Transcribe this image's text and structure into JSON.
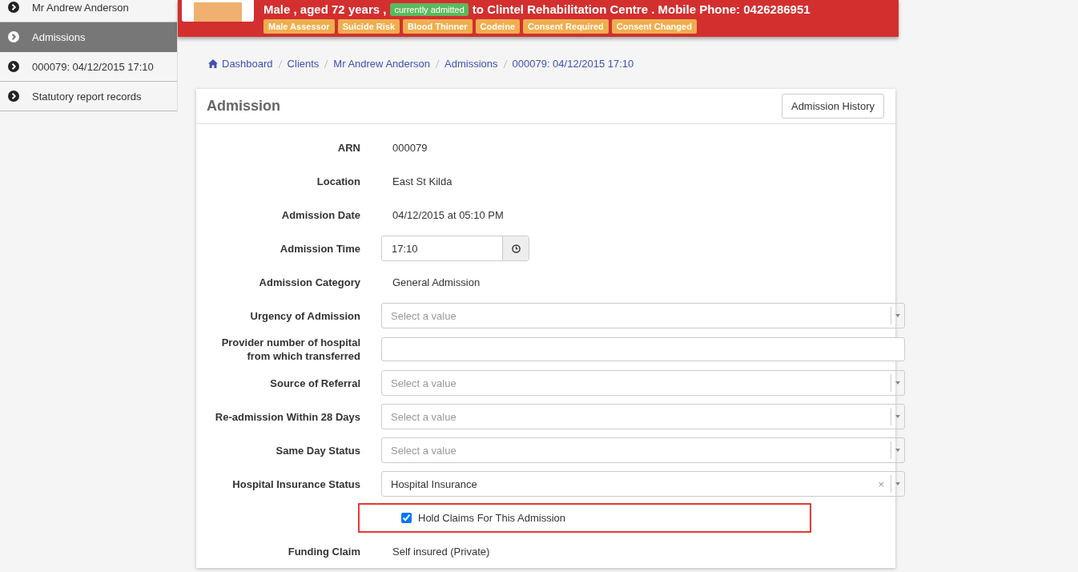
{
  "sidebar": {
    "items": [
      {
        "label": "Mr Andrew Anderson",
        "selected": false
      },
      {
        "label": "Admissions",
        "selected": true
      },
      {
        "label": "000079: 04/12/2015 17:10",
        "selected": false
      },
      {
        "label": "Statutory report records",
        "selected": false
      }
    ]
  },
  "patient_header": {
    "summary": "Male , aged 72 years ,",
    "status_badge": "currently admitted",
    "summary_rest": "to Clintel Rehabilitation Centre . Mobile Phone: 0426286951",
    "alerts": [
      "Male Assessor",
      "Suicide Risk",
      "Blood Thinner",
      "Codeine",
      "Consent Required",
      "Consent Changed"
    ]
  },
  "breadcrumb": [
    "Dashboard",
    "Clients",
    "Mr Andrew Anderson",
    "Admissions",
    "000079: 04/12/2015 17:10"
  ],
  "card": {
    "title": "Admission",
    "history_button": "Admission History",
    "fields": [
      {
        "kind": "text",
        "label": "ARN",
        "value": "000079"
      },
      {
        "kind": "text",
        "label": "Location",
        "value": "East St Kilda"
      },
      {
        "kind": "text",
        "label": "Admission Date",
        "value": "04/12/2015 at 05:10 PM"
      },
      {
        "kind": "time",
        "label": "Admission Time",
        "value": "17:10"
      },
      {
        "kind": "text",
        "label": "Admission Category",
        "value": "General Admission"
      },
      {
        "kind": "select",
        "label": "Urgency of Admission",
        "placeholder": "Select a value"
      },
      {
        "kind": "input",
        "label": "Provider number of hospital from which transferred"
      },
      {
        "kind": "select",
        "label": "Source of Referral",
        "placeholder": "Select a value"
      },
      {
        "kind": "select",
        "label": "Re-admission Within 28 Days",
        "placeholder": "Select a value"
      },
      {
        "kind": "select",
        "label": "Same Day Status",
        "placeholder": "Select a value"
      },
      {
        "kind": "select",
        "label": "Hospital Insurance Status",
        "value": "Hospital Insurance",
        "clear": "×"
      },
      {
        "kind": "checkbox",
        "label": "Hold Claims For This Admission",
        "checked": true
      },
      {
        "kind": "text",
        "label": "Funding Claim",
        "value": "Self insured (Private)"
      }
    ]
  }
}
